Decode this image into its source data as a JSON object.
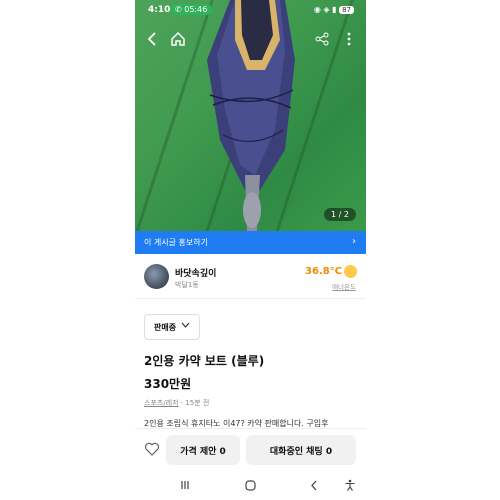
{
  "status_bar": {
    "time": "4:10",
    "call_time": "05:46",
    "battery": "87"
  },
  "photo": {
    "counter": "1 / 2"
  },
  "promo": {
    "text": "이 게시글 홍보하기"
  },
  "seller": {
    "name": "바닷속깊이",
    "location": "박달1동",
    "manner_temp": "36.8°C",
    "manner_label": "매너온도"
  },
  "listing": {
    "status": "판매중",
    "title": "2인용 카약 보트 (블루)",
    "price": "330만원",
    "category": "스포츠/레저",
    "time_ago": "· 15분 전",
    "description": "2인용 조립식 휴지타노 이47? 카약 판매합니다. 구입후"
  },
  "bottom": {
    "offer_button": "가격 제안 0",
    "chat_button": "대화중인 채팅 0"
  },
  "icons": [
    "back-icon",
    "home-icon",
    "share-icon",
    "more-icon",
    "chevron-right-icon",
    "chevron-down-icon",
    "heart-icon",
    "recent-apps-icon",
    "android-home-icon",
    "android-back-icon",
    "accessibility-icon"
  ]
}
